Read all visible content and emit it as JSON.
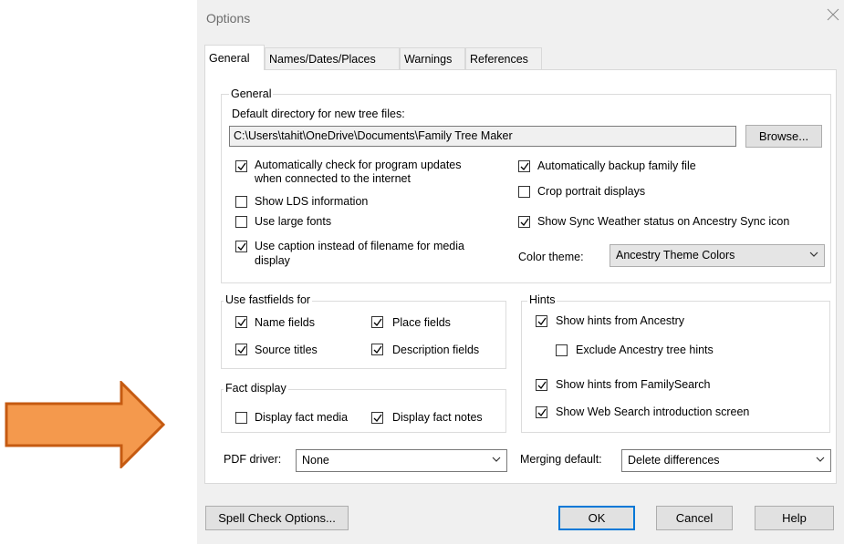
{
  "dialog": {
    "title": "Options"
  },
  "tabs": [
    "General",
    "Names/Dates/Places",
    "Warnings",
    "References"
  ],
  "general_group": {
    "legend": "General",
    "default_dir_label": "Default directory for new tree files:",
    "default_dir_value": "C:\\Users\\tahit\\OneDrive\\Documents\\Family Tree Maker",
    "browse_label": "Browse...",
    "auto_check_updates": {
      "line1": "Automatically check for program updates",
      "line2": "when connected to the internet",
      "checked": true
    },
    "show_lds": {
      "label": "Show LDS information",
      "checked": false
    },
    "large_fonts": {
      "label": "Use large fonts",
      "checked": false
    },
    "use_caption": {
      "line1": "Use caption instead of filename for media",
      "line2": "display",
      "checked": true
    },
    "auto_backup": {
      "label": "Automatically backup family file",
      "checked": true
    },
    "crop_portrait": {
      "label": "Crop portrait displays",
      "checked": false
    },
    "sync_weather": {
      "label": "Show Sync Weather status on Ancestry Sync icon",
      "checked": true
    },
    "color_theme_label": "Color theme:",
    "color_theme_value": "Ancestry Theme Colors"
  },
  "fastfields": {
    "legend": "Use fastfields for",
    "name_fields": {
      "label": "Name fields",
      "checked": true
    },
    "place_fields": {
      "label": "Place fields",
      "checked": true
    },
    "source_titles": {
      "label": "Source titles",
      "checked": true
    },
    "description_fields": {
      "label": "Description fields",
      "checked": true
    }
  },
  "fact_display": {
    "legend": "Fact display",
    "fact_media": {
      "label": "Display fact media",
      "checked": false
    },
    "fact_notes": {
      "label": "Display fact notes",
      "checked": true
    }
  },
  "hints": {
    "legend": "Hints",
    "from_ancestry": {
      "label": "Show hints from Ancestry",
      "checked": true
    },
    "exclude_tree": {
      "label": "Exclude Ancestry tree hints",
      "checked": false
    },
    "from_familysearch": {
      "label": "Show hints from FamilySearch",
      "checked": true
    },
    "web_search_intro": {
      "label": "Show Web Search introduction screen",
      "checked": true
    }
  },
  "pdf_driver": {
    "label": "PDF driver:",
    "value": "None"
  },
  "merging_default": {
    "label": "Merging default:",
    "value": "Delete differences"
  },
  "footer": {
    "spell_check": "Spell Check Options...",
    "ok": "OK",
    "cancel": "Cancel",
    "help": "Help"
  },
  "colors": {
    "arrow_fill": "#f4994d",
    "arrow_stroke": "#c55a11",
    "dialog_bg": "#f0f0f0",
    "focus_border": "#0078d7"
  }
}
